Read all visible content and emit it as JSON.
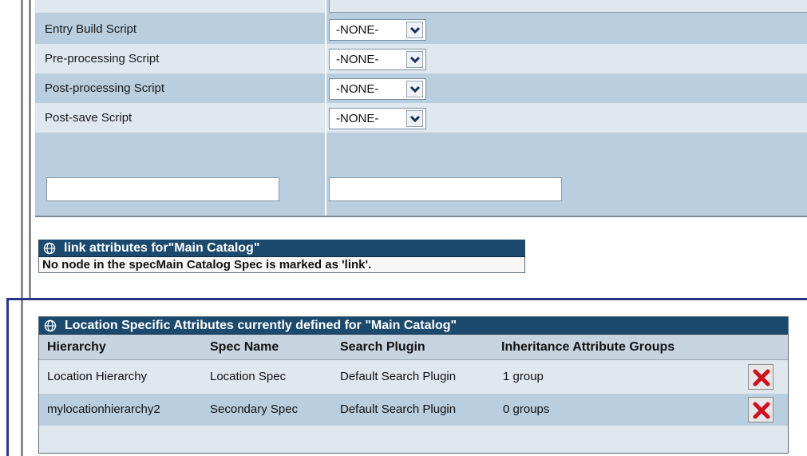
{
  "script_settings": {
    "rows": [
      {
        "label": "Entry Build Script",
        "value": "-NONE-"
      },
      {
        "label": "Pre-processing Script",
        "value": "-NONE-"
      },
      {
        "label": "Post-processing Script",
        "value": "-NONE-"
      },
      {
        "label": "Post-save Script",
        "value": "-NONE-"
      }
    ],
    "new_name_value": "",
    "new_value_value": ""
  },
  "link_panel": {
    "title": "link attributes for\"Main Catalog\"",
    "message": "No node in the specMain Catalog Spec is marked as 'link'."
  },
  "location_panel": {
    "title": "Location Specific Attributes currently defined for \"Main Catalog\"",
    "columns": [
      "Hierarchy",
      "Spec Name",
      "Search Plugin",
      "Inheritance Attribute Groups"
    ],
    "rows": [
      {
        "hierarchy": "Location Hierarchy",
        "spec": "Location Spec",
        "plugin": "Default Search Plugin",
        "groups": "1 group"
      },
      {
        "hierarchy": "mylocationhierarchy2",
        "spec": "Secondary Spec",
        "plugin": "Default Search Plugin",
        "groups": "0 groups"
      }
    ]
  },
  "icons": {
    "panel_icon": "globe-icon",
    "row_action": "delete-x-icon",
    "dropdown": "chevron-down-icon"
  },
  "colors": {
    "panel_header": "#1c4a6e",
    "row_light": "#dfe7ef",
    "row_dark": "#b9cedf",
    "delete_red": "#d0101c",
    "focus_frame": "#2a3390"
  }
}
